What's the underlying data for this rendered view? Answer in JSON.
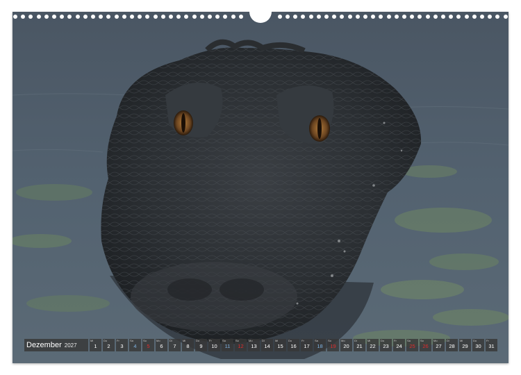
{
  "calendar": {
    "month": "Dezember",
    "year": "2027",
    "days": [
      {
        "d": "1",
        "wd": "Mi",
        "type": "weekday"
      },
      {
        "d": "2",
        "wd": "Do",
        "type": "weekday"
      },
      {
        "d": "3",
        "wd": "Fr",
        "type": "weekday"
      },
      {
        "d": "4",
        "wd": "Sa",
        "type": "saturday"
      },
      {
        "d": "5",
        "wd": "So",
        "type": "sunday"
      },
      {
        "d": "6",
        "wd": "Mo",
        "type": "weekday"
      },
      {
        "d": "7",
        "wd": "Di",
        "type": "weekday"
      },
      {
        "d": "8",
        "wd": "Mi",
        "type": "weekday"
      },
      {
        "d": "9",
        "wd": "Do",
        "type": "weekday"
      },
      {
        "d": "10",
        "wd": "Fr",
        "type": "weekday"
      },
      {
        "d": "11",
        "wd": "Sa",
        "type": "saturday"
      },
      {
        "d": "12",
        "wd": "So",
        "type": "sunday"
      },
      {
        "d": "13",
        "wd": "Mo",
        "type": "weekday"
      },
      {
        "d": "14",
        "wd": "Di",
        "type": "weekday"
      },
      {
        "d": "15",
        "wd": "Mi",
        "type": "weekday"
      },
      {
        "d": "16",
        "wd": "Do",
        "type": "weekday"
      },
      {
        "d": "17",
        "wd": "Fr",
        "type": "weekday"
      },
      {
        "d": "18",
        "wd": "Sa",
        "type": "saturday"
      },
      {
        "d": "19",
        "wd": "So",
        "type": "sunday"
      },
      {
        "d": "20",
        "wd": "Mo",
        "type": "weekday"
      },
      {
        "d": "21",
        "wd": "Di",
        "type": "weekday"
      },
      {
        "d": "22",
        "wd": "Mi",
        "type": "weekday"
      },
      {
        "d": "23",
        "wd": "Do",
        "type": "weekday"
      },
      {
        "d": "24",
        "wd": "Fr",
        "type": "weekday"
      },
      {
        "d": "25",
        "wd": "Sa",
        "type": "holiday"
      },
      {
        "d": "26",
        "wd": "So",
        "type": "sunday"
      },
      {
        "d": "27",
        "wd": "Mo",
        "type": "weekday"
      },
      {
        "d": "28",
        "wd": "Di",
        "type": "weekday"
      },
      {
        "d": "29",
        "wd": "Mi",
        "type": "weekday"
      },
      {
        "d": "30",
        "wd": "Do",
        "type": "weekday"
      },
      {
        "d": "31",
        "wd": "Fr",
        "type": "weekday"
      }
    ]
  },
  "colors": {
    "water": "#4f5d68",
    "algae": "#6f8763",
    "croc_skin": "#2b2e31",
    "eye": "#8a5a2a",
    "sunday": "#e02b2b",
    "saturday": "#7fb2e0",
    "cell_bg": "#373737"
  }
}
